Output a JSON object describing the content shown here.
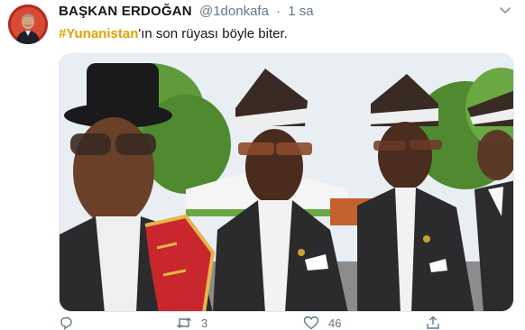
{
  "tweet": {
    "author_name": "BAŞKAN ERDOĞAN",
    "handle": "@1donkafa",
    "separator": "·",
    "time": "1 sa",
    "hashtag": "#Yunanistan",
    "text_rest": "'ın son rüyası böyle biter."
  },
  "actions": {
    "reply_count": "",
    "retweet_count": "3",
    "like_count": "46",
    "share_count": ""
  },
  "icons": [
    "chevron-down-icon",
    "reply-icon",
    "retweet-icon",
    "like-icon",
    "share-icon"
  ],
  "colors": {
    "hashtag": "#e7a000",
    "secondary_text": "#657786",
    "primary_text": "#14171a"
  }
}
